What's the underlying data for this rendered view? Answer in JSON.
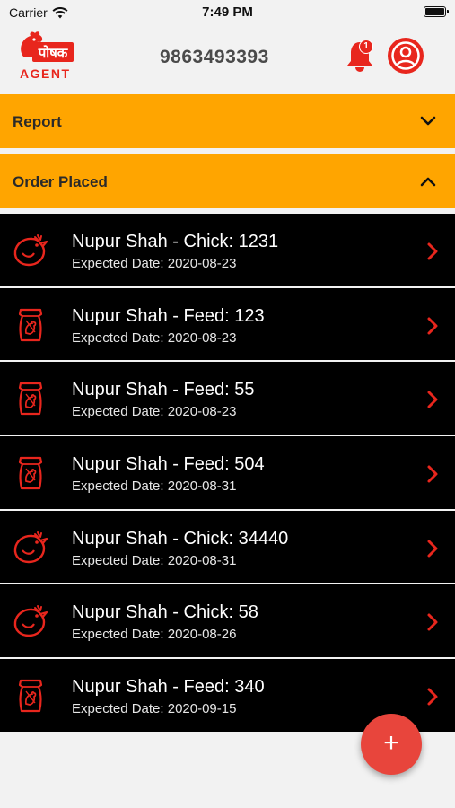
{
  "status_bar": {
    "carrier": "Carrier",
    "time": "7:49 PM"
  },
  "header": {
    "logo_text": "पोषक",
    "logo_sub": "AGENT",
    "phone": "9863493393",
    "notification_count": "1"
  },
  "sections": [
    {
      "label": "Report",
      "state": "collapsed"
    },
    {
      "label": "Order Placed",
      "state": "expanded"
    }
  ],
  "orders": [
    {
      "icon": "chick-icon",
      "title": "Nupur Shah - Chick: 1231",
      "expected": "Expected Date: 2020-08-23"
    },
    {
      "icon": "feed-bag-icon",
      "title": "Nupur Shah - Feed: 123",
      "expected": "Expected Date: 2020-08-23"
    },
    {
      "icon": "feed-bag-icon",
      "title": "Nupur Shah - Feed: 55",
      "expected": "Expected Date: 2020-08-23"
    },
    {
      "icon": "feed-bag-icon",
      "title": "Nupur Shah - Feed: 504",
      "expected": "Expected Date: 2020-08-31"
    },
    {
      "icon": "chick-icon",
      "title": "Nupur Shah - Chick: 34440",
      "expected": "Expected Date: 2020-08-31"
    },
    {
      "icon": "chick-icon",
      "title": "Nupur Shah - Chick: 58",
      "expected": "Expected Date: 2020-08-26"
    },
    {
      "icon": "feed-bag-icon",
      "title": "Nupur Shah - Feed: 340",
      "expected": "Expected Date: 2020-09-15"
    }
  ],
  "fab": {
    "label": "+"
  },
  "colors": {
    "accent": "#ffa500",
    "brand_red": "#e8261d",
    "row_bg": "#000000"
  }
}
